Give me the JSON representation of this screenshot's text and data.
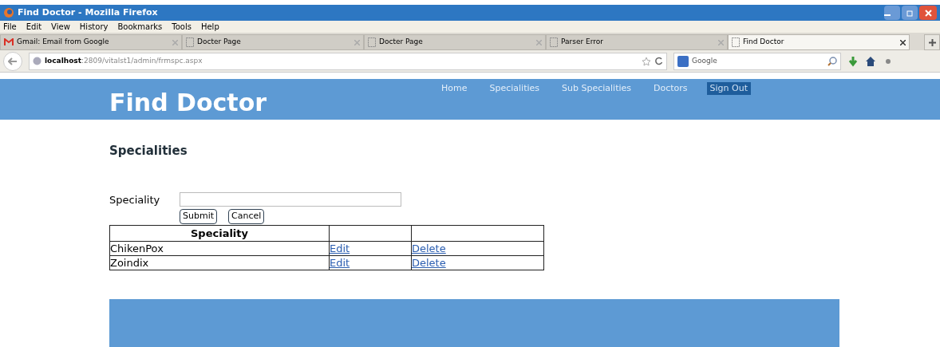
{
  "window": {
    "title": "Find Doctor - Mozilla Firefox"
  },
  "menu": [
    "File",
    "Edit",
    "View",
    "History",
    "Bookmarks",
    "Tools",
    "Help"
  ],
  "tabs": [
    {
      "label": "Gmail: Email from Google",
      "kind": "gmail",
      "selected": false
    },
    {
      "label": "Docter Page",
      "kind": "page",
      "selected": false
    },
    {
      "label": "Docter Page",
      "kind": "page",
      "selected": false
    },
    {
      "label": "Parser Error",
      "kind": "page",
      "selected": false
    },
    {
      "label": "Find Doctor",
      "kind": "page",
      "selected": true
    }
  ],
  "address": {
    "host": "localhost",
    "path": ":2809/vitalst1/admin/frmspc.aspx"
  },
  "search": {
    "placeholder": "Google"
  },
  "site": {
    "title": "Find Doctor",
    "nav": [
      {
        "label": "Home",
        "selected": false
      },
      {
        "label": "Specialities",
        "selected": false
      },
      {
        "label": "Sub Specialities",
        "selected": false
      },
      {
        "label": "Doctors",
        "selected": false
      },
      {
        "label": "Sign Out",
        "selected": true
      }
    ]
  },
  "heading": "Specialities",
  "form": {
    "label": "Speciality",
    "buttons": [
      "Submit",
      "Cancel"
    ]
  },
  "table": {
    "columns": [
      "Speciality"
    ],
    "rows": [
      {
        "name": "ChikenPox",
        "edit": "Edit",
        "delete": "Delete"
      },
      {
        "name": "Zoindix",
        "edit": "Edit",
        "delete": "Delete"
      }
    ]
  }
}
